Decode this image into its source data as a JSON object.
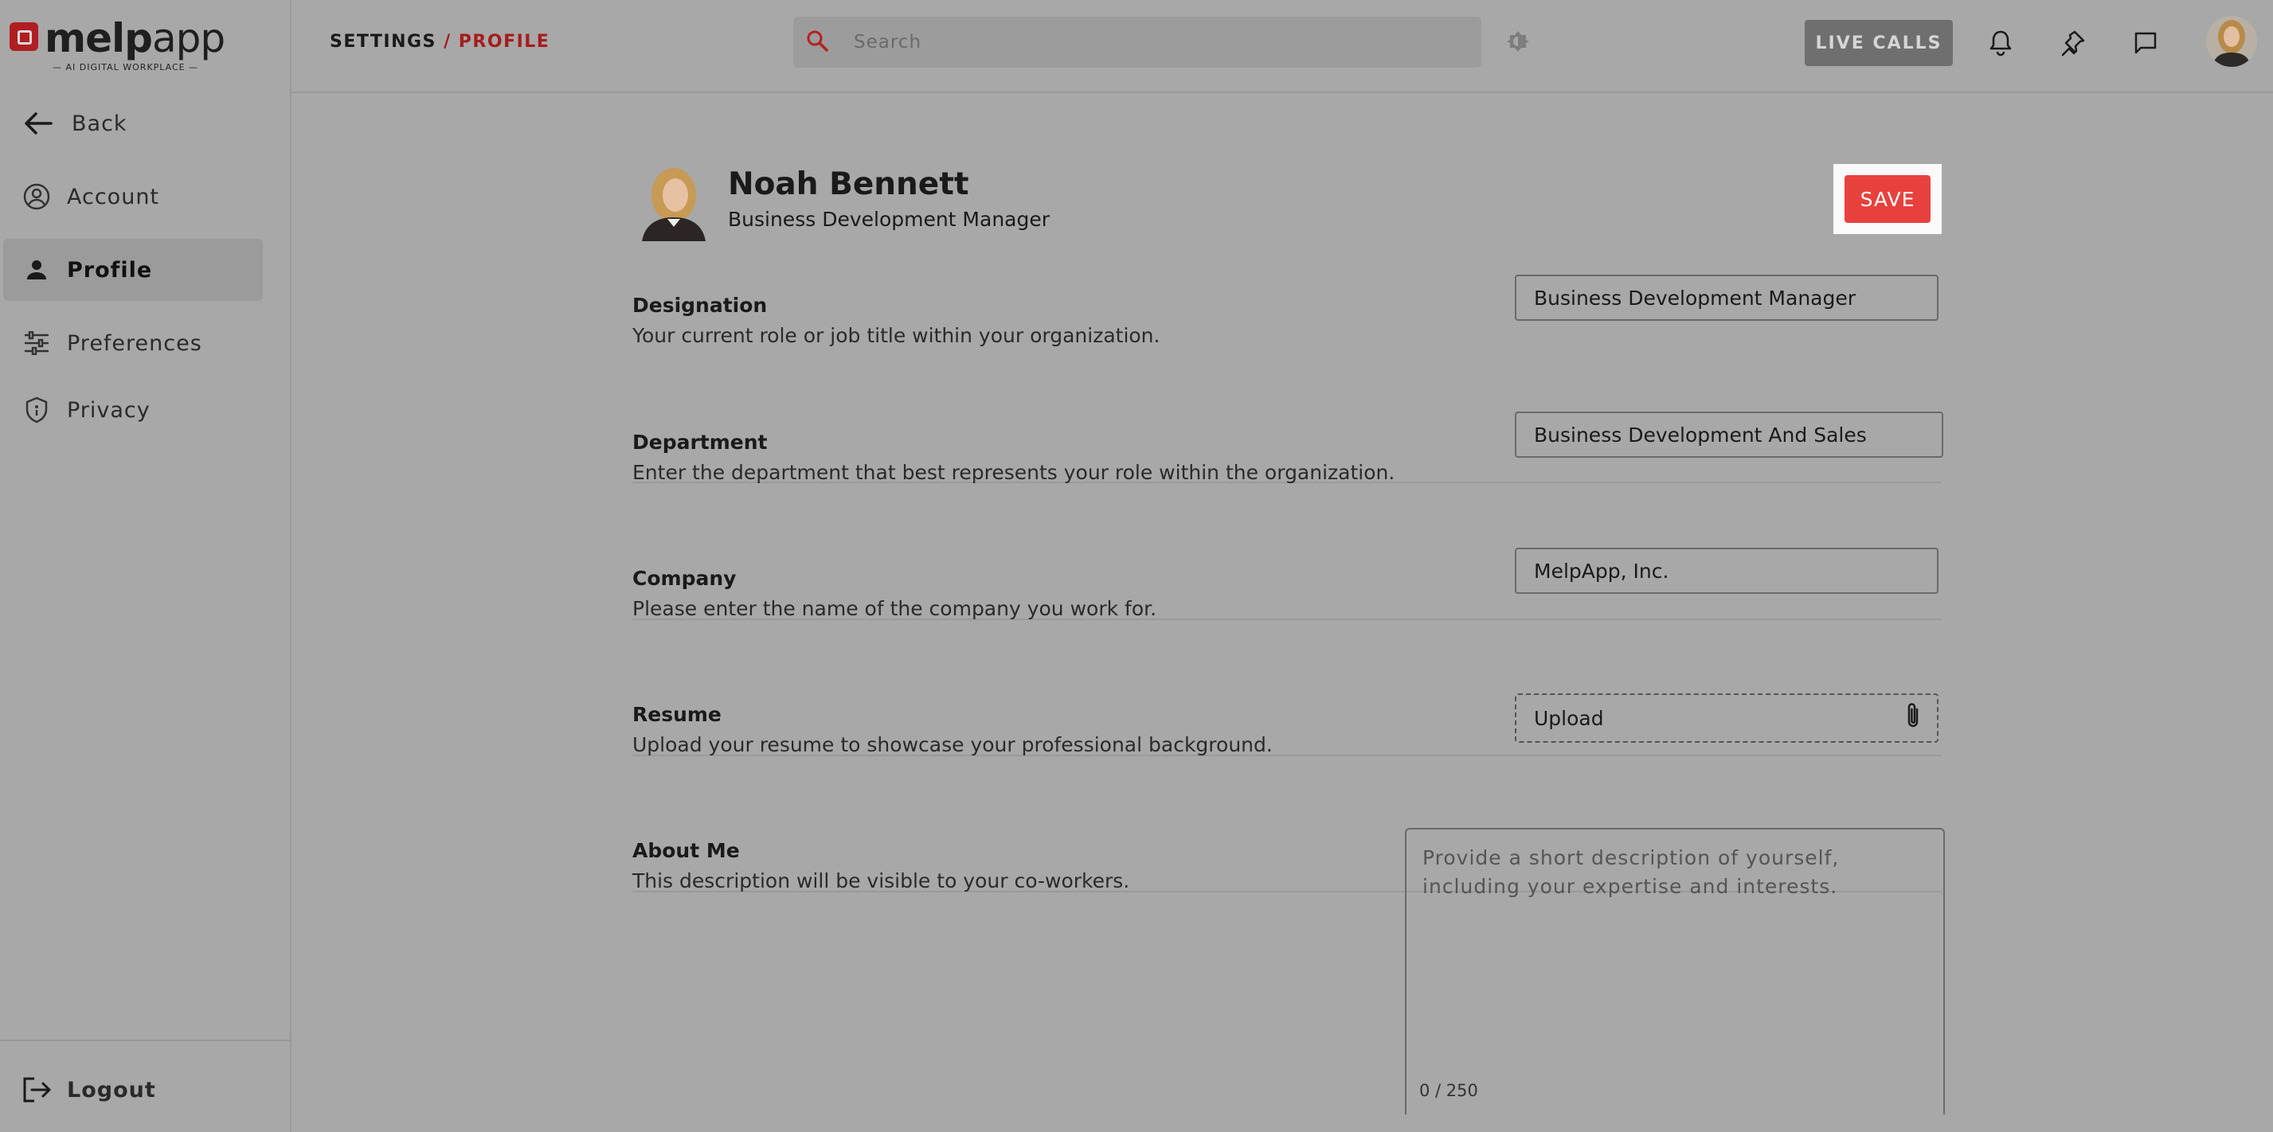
{
  "brand": {
    "name_bold": "melp",
    "name_light": "app",
    "tagline": "— AI DIGITAL WORKPLACE —"
  },
  "sidebar": {
    "back_label": "Back",
    "items": [
      {
        "label": "Account",
        "icon": "account-circle-icon"
      },
      {
        "label": "Profile",
        "icon": "person-icon",
        "active": true
      },
      {
        "label": "Preferences",
        "icon": "sliders-icon"
      },
      {
        "label": "Privacy",
        "icon": "shield-icon"
      }
    ],
    "logout_label": "Logout"
  },
  "header": {
    "breadcrumb": {
      "root": "SETTINGS",
      "sep": "/",
      "current": "PROFILE"
    },
    "search_placeholder": "Search",
    "live_calls_label": "LIVE CALLS"
  },
  "profile": {
    "name": "Noah Bennett",
    "role": "Business Development Manager",
    "save_label": "SAVE"
  },
  "fields": {
    "designation": {
      "label": "Designation",
      "description": "Your current role or job title within your organization.",
      "value": "Business Development Manager"
    },
    "department": {
      "label": "Department",
      "description": "Enter the department that best represents your role within the organization.",
      "value": "Business Development And Sales"
    },
    "company": {
      "label": "Company",
      "description": "Please enter the name of the company you work for.",
      "value": "MelpApp, Inc."
    },
    "resume": {
      "label": "Resume",
      "description": "Upload your resume to showcase your professional background.",
      "upload_label": "Upload"
    },
    "about": {
      "label": "About Me",
      "description": "This description will be visible to your co-workers.",
      "placeholder": "Provide a short description of yourself, including your expertise and interests.",
      "counter": "0 / 250"
    }
  },
  "colors": {
    "accent": "#e8413d",
    "breadcrumb_current": "#a61c1c",
    "background": "#a8a8a8"
  }
}
